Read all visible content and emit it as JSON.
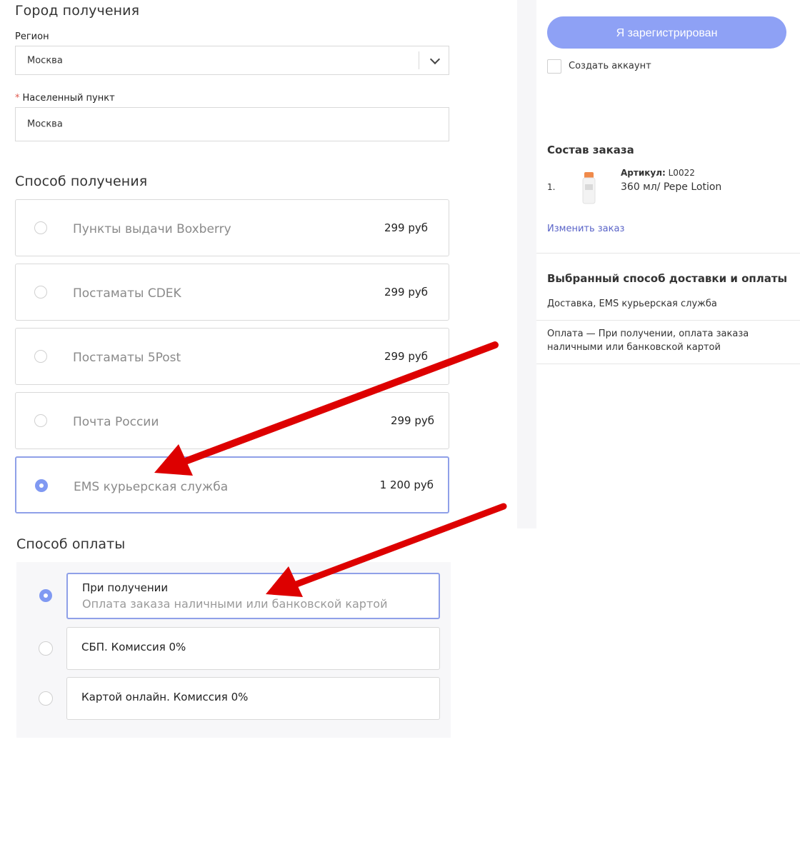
{
  "city": {
    "title": "Город получения",
    "region_label": "Регион",
    "region_value": "Москва",
    "locality_required_mark": "*",
    "locality_label": "Населенный пункт",
    "locality_value": "Москва"
  },
  "delivery": {
    "title": "Способ получения",
    "options": [
      {
        "name": "Пункты выдачи Boxberry",
        "price": "299 руб",
        "selected": false
      },
      {
        "name": "Постаматы CDEK",
        "price": "299 руб",
        "selected": false
      },
      {
        "name": "Постаматы 5Post",
        "price": "299 руб",
        "selected": false
      },
      {
        "name": "Почта России",
        "price": "299 руб",
        "selected": false
      },
      {
        "name": "EMS курьерская служба",
        "price": "1 200 руб",
        "selected": true
      }
    ]
  },
  "payment": {
    "title": "Способ оплаты",
    "options": [
      {
        "title": "При получении",
        "subtitle": "Оплата заказа наличными или банковской картой",
        "selected": true
      },
      {
        "title": "СБП. Комиссия 0%",
        "selected": false
      },
      {
        "title": "Картой онлайн. Комиссия 0%",
        "selected": false
      }
    ]
  },
  "sidebar": {
    "register_button": "Я зарегистрирован",
    "create_account_label": "Создать аккаунт",
    "order_title": "Состав заказа",
    "item_index": "1.",
    "item_article_label": "Артикул:",
    "item_article_value": "L0022",
    "item_name": "360 мл/ Pepe Lotion",
    "change_order_link": "Изменить заказ",
    "summary_title": "Выбранный способ доставки и оплаты",
    "summary_delivery": "Доставка, EMS курьерская служба",
    "summary_payment_line1": "Оплата — При получении, оплата заказа",
    "summary_payment_line2": "наличными или банковской картой"
  },
  "colors": {
    "accent": "#8099f2",
    "button": "#8ea1f5",
    "annotation_arrow": "#dd0000"
  },
  "icons": {
    "select_toggle": "chevron-down-icon",
    "annotation": "arrow-icon"
  }
}
